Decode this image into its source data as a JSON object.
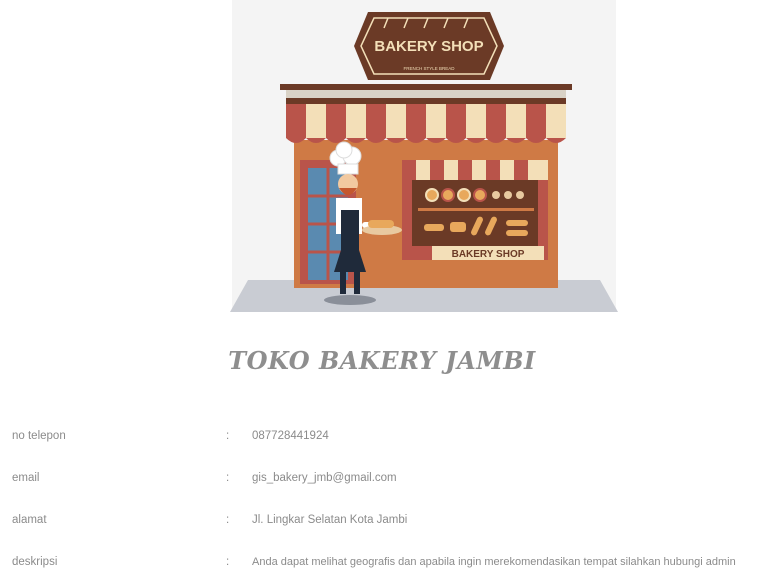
{
  "store": {
    "logo_text": "BAKERY SHOP",
    "logo_subtext": "FRENCH STYLE BREAD",
    "window_sign": "BAKERY SHOP",
    "name": "TOKO BAKERY JAMBI"
  },
  "details": [
    {
      "label": "no telepon",
      "separator": ":",
      "value": "087728441924"
    },
    {
      "label": "email",
      "separator": ":",
      "value": "gis_bakery_jmb@gmail.com"
    },
    {
      "label": "alamat",
      "separator": ":",
      "value": "Jl. Lingkar Selatan Kota Jambi"
    },
    {
      "label": "deskripsi",
      "separator": ":",
      "value": "Anda dapat melihat geografis dan apabila ingin merekomendasikan tempat silahkan hubungi admin"
    }
  ],
  "colors": {
    "brown": "#6b3a26",
    "awning_red": "#b9544a",
    "awning_cream": "#f3dfb8",
    "wall_orange": "#cf7a45",
    "text_gray": "#8b8b8b"
  }
}
